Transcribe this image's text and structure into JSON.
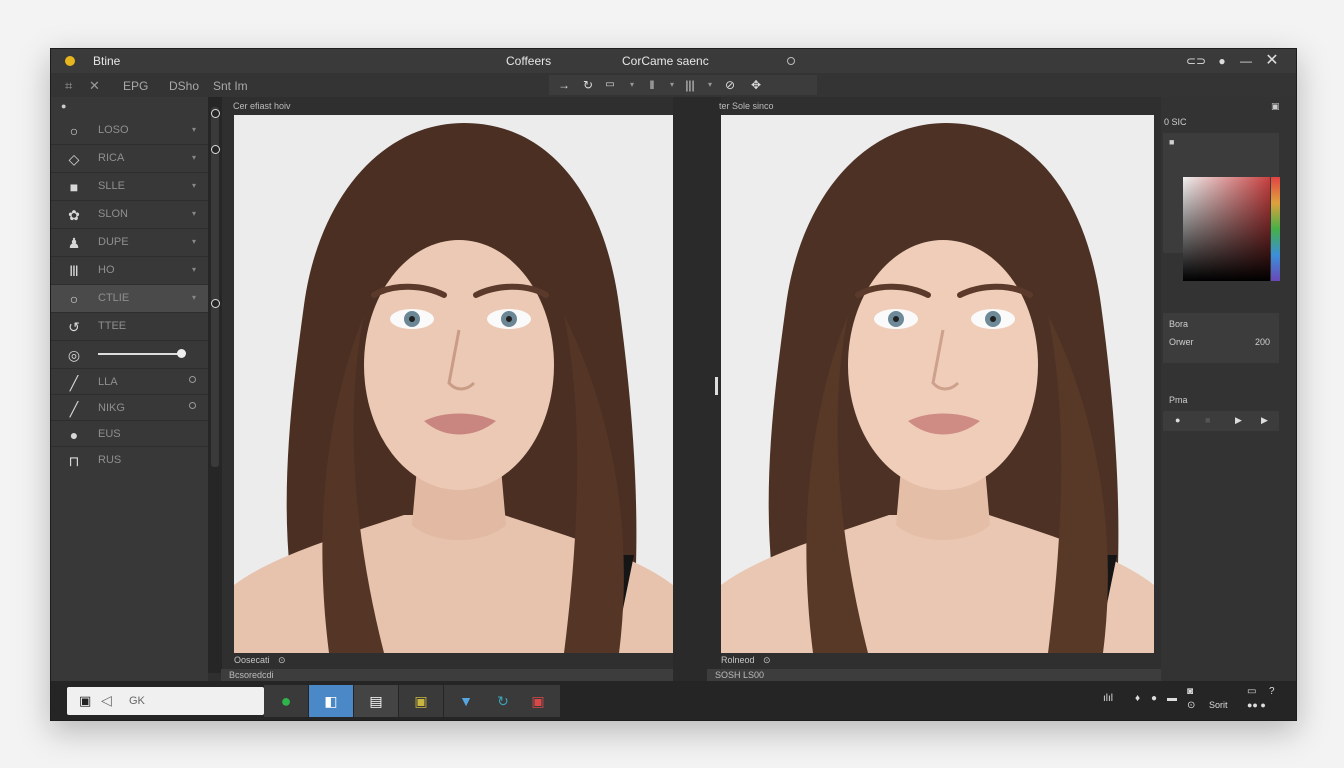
{
  "window": {
    "app_name": "Btine",
    "title_left": "Coffeers",
    "title_right": "CorCame saenc"
  },
  "menu": {
    "items": [
      "EPG",
      "DSho",
      "Snt Im"
    ]
  },
  "tools": {
    "header_label": "",
    "items": [
      {
        "label": "LOSO",
        "icon": "circle-icon"
      },
      {
        "label": "RICA",
        "icon": "diamond-icon"
      },
      {
        "label": "SLLE",
        "icon": "square-icon"
      },
      {
        "label": "SLON",
        "icon": "blob-icon"
      },
      {
        "label": "DUPE",
        "icon": "stamp-icon"
      },
      {
        "label": "HO",
        "icon": "columns-icon"
      },
      {
        "label": "CTLIE",
        "icon": "circle-icon"
      },
      {
        "label": "TTEE",
        "icon": "undo-icon"
      },
      {
        "label": "",
        "icon": "lasso-icon"
      },
      {
        "label": "LLA",
        "icon": "brush-icon"
      },
      {
        "label": "NIKG",
        "icon": "pen-icon"
      },
      {
        "label": "EUS",
        "icon": "dot-icon"
      },
      {
        "label": "RUS",
        "icon": "stamp-base-icon"
      }
    ]
  },
  "left_canvas": {
    "label": "Cer efiast hoiv",
    "foot_label": "Oosecati",
    "bar_label": "Bcsoredcdi"
  },
  "right_canvas": {
    "label": "ter Sole sinco",
    "foot_label": "Rolneod",
    "bar_label": "SOSH LS00"
  },
  "right_panel": {
    "color_title": "0 SIC",
    "section_title": "Bora",
    "prop_label": "Orwer",
    "prop_value": "200",
    "play_title": "Pma"
  },
  "taskbar": {
    "search_text": "GK",
    "tray_label": "Sorit"
  },
  "colors": {
    "window_bg": "#2f2f2f",
    "accent_yellow": "#e7b51c",
    "canvas_bg": "#e9e9e9"
  }
}
